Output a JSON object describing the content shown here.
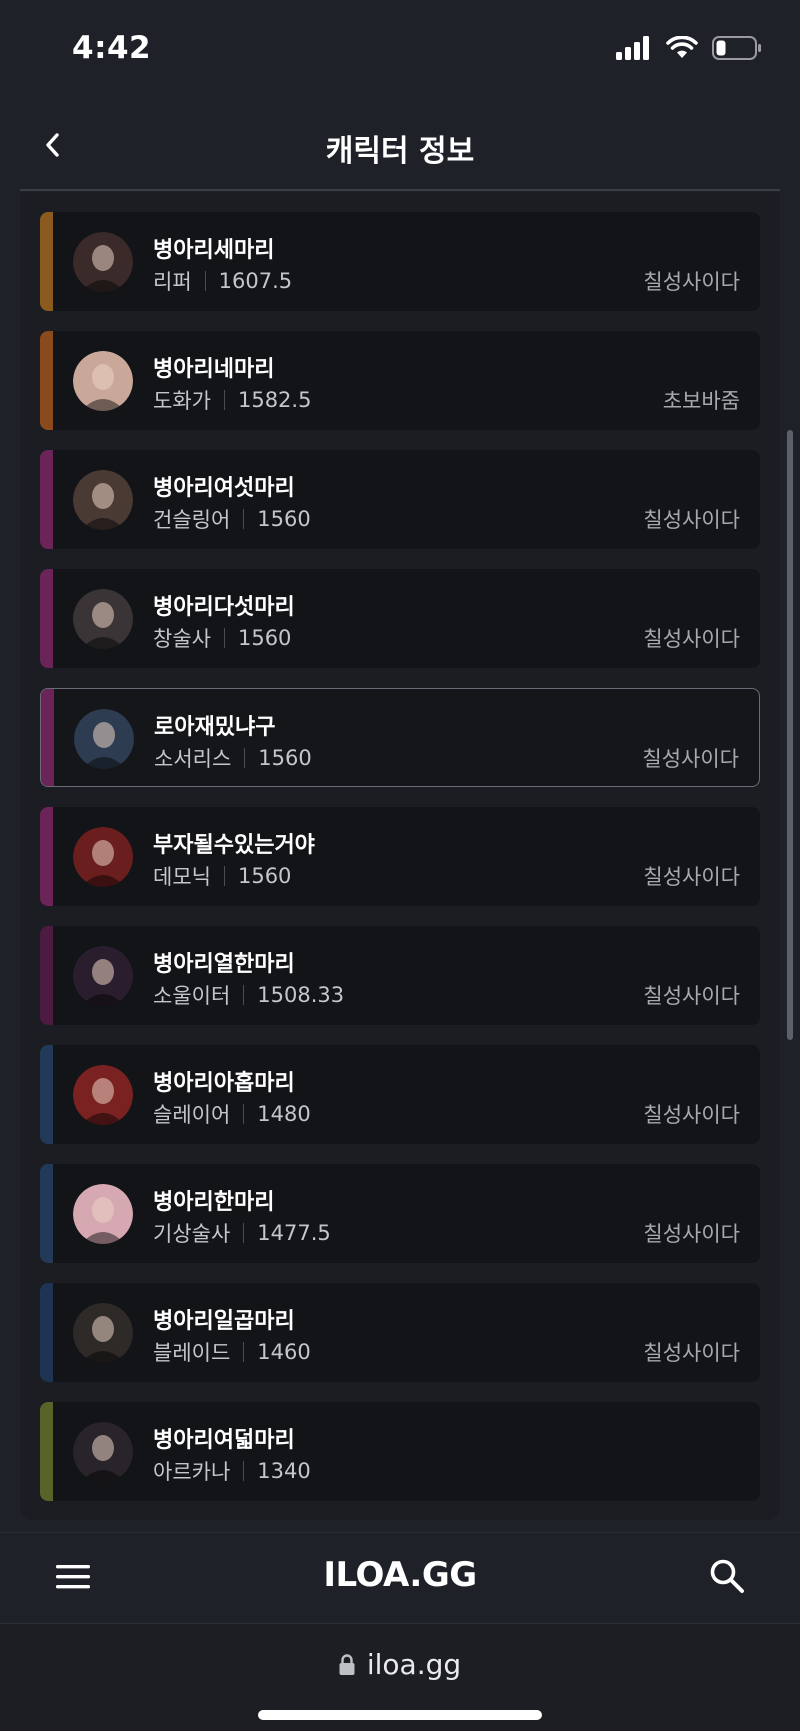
{
  "status": {
    "time": "4:42"
  },
  "header": {
    "title": "캐릭터 정보"
  },
  "characters": [
    {
      "name": "병아리세마리",
      "class": "리퍼",
      "item_level": "1607.5",
      "guild": "칠성사이다",
      "accent": "#8a5a1e",
      "avatar_color": "#3b2a2a"
    },
    {
      "name": "병아리네마리",
      "class": "도화가",
      "item_level": "1582.5",
      "guild": "초보바줌",
      "accent": "#8a4a1c",
      "avatar_color": "#c9a89a"
    },
    {
      "name": "병아리여섯마리",
      "class": "건슬링어",
      "item_level": "1560",
      "guild": "칠성사이다",
      "accent": "#6b2458",
      "avatar_color": "#4a3a34"
    },
    {
      "name": "병아리다섯마리",
      "class": "창술사",
      "item_level": "1560",
      "guild": "칠성사이다",
      "accent": "#6b2458",
      "avatar_color": "#3a3436"
    },
    {
      "name": "로아재밌냐구",
      "class": "소서리스",
      "item_level": "1560",
      "guild": "칠성사이다",
      "accent": "#6b2458",
      "avatar_color": "#2e3c52",
      "selected": true
    },
    {
      "name": "부자될수있는거야",
      "class": "데모닉",
      "item_level": "1560",
      "guild": "칠성사이다",
      "accent": "#6b2458",
      "avatar_color": "#6a1e1e"
    },
    {
      "name": "병아리열한마리",
      "class": "소울이터",
      "item_level": "1508.33",
      "guild": "칠성사이다",
      "accent": "#4d1a42",
      "avatar_color": "#2a1e2e"
    },
    {
      "name": "병아리아홉마리",
      "class": "슬레이어",
      "item_level": "1480",
      "guild": "칠성사이다",
      "accent": "#223a58",
      "avatar_color": "#7a2222"
    },
    {
      "name": "병아리한마리",
      "class": "기상술사",
      "item_level": "1477.5",
      "guild": "칠성사이다",
      "accent": "#223a58",
      "avatar_color": "#d6a8b2"
    },
    {
      "name": "병아리일곱마리",
      "class": "블레이드",
      "item_level": "1460",
      "guild": "칠성사이다",
      "accent": "#1e3452",
      "avatar_color": "#2e2a28"
    },
    {
      "name": "병아리여덟마리",
      "class": "아르카나",
      "item_level": "1340",
      "guild": "",
      "accent": "#56642a",
      "avatar_color": "#28242a"
    }
  ],
  "nav": {
    "logo": "ILOA.GG",
    "menu_icon": "hamburger-icon",
    "search_icon": "search-icon"
  },
  "browser": {
    "url": "iloa.gg"
  }
}
